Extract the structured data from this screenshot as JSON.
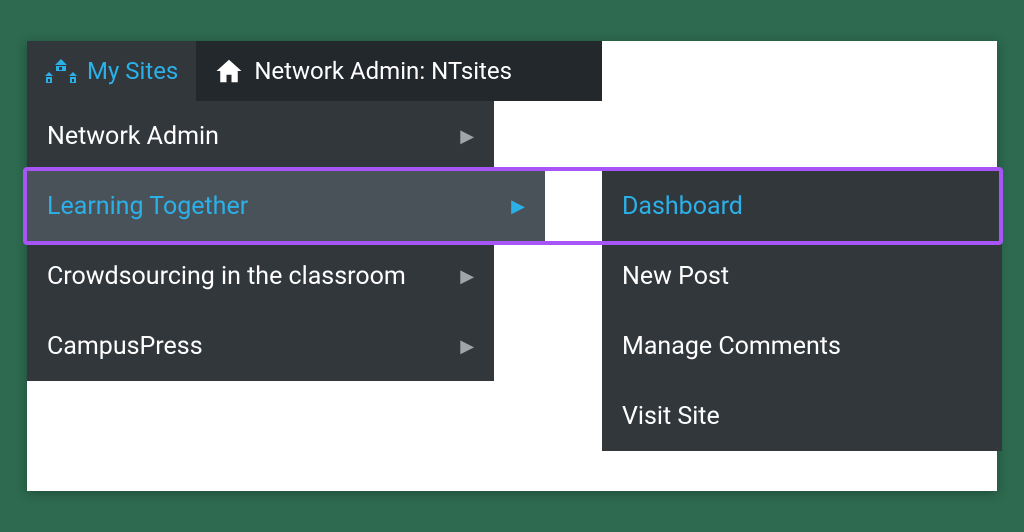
{
  "topbar": {
    "mysites": {
      "label": "My Sites"
    },
    "networkadmin": {
      "label": "Network Admin: NTsites"
    }
  },
  "menu": {
    "items": [
      {
        "label": "Network Admin"
      },
      {
        "label": "Learning Together"
      },
      {
        "label": "Crowdsourcing in the classroom"
      },
      {
        "label": "CampusPress"
      }
    ]
  },
  "submenu": {
    "items": [
      {
        "label": "Dashboard"
      },
      {
        "label": "New Post"
      },
      {
        "label": "Manage Comments"
      },
      {
        "label": "Visit Site"
      }
    ]
  }
}
